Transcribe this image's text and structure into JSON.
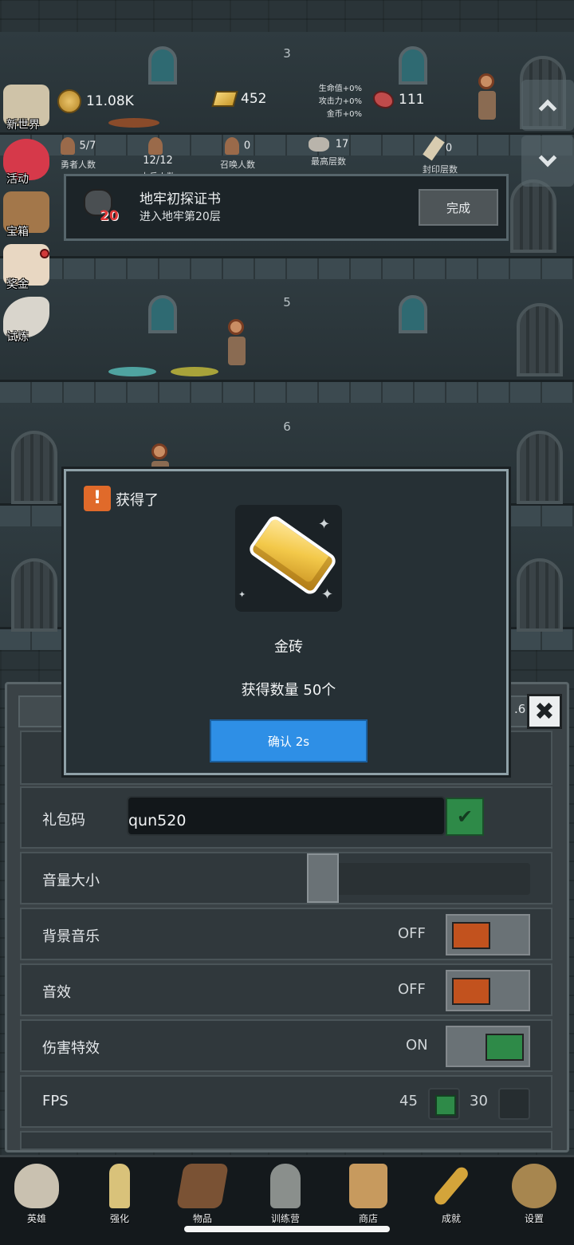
{
  "floors": [
    {
      "label": "3"
    },
    {
      "label": "5"
    },
    {
      "label": "6"
    }
  ],
  "hud": {
    "gold": "11.08K",
    "gold_bars": "452",
    "bonus_lines": [
      "生命值+0%",
      "攻击力+0%",
      "金币+0%"
    ],
    "gems": "111",
    "stats": [
      {
        "value": "5/7",
        "label": "勇者人数"
      },
      {
        "value": "12/12",
        "label": "士兵人数"
      },
      {
        "value": "0",
        "label": "召唤人数"
      },
      {
        "value": "17",
        "label": "最高层数"
      },
      {
        "value": "0",
        "label": "封印层数"
      }
    ]
  },
  "side_menu": [
    {
      "label": "新世界"
    },
    {
      "label": "活动"
    },
    {
      "label": "宝箱"
    },
    {
      "label": "奖金"
    },
    {
      "label": "试炼"
    }
  ],
  "quest": {
    "title": "地牢初探证书",
    "description": "进入地牢第20层",
    "badge_number": "20",
    "button": "完成"
  },
  "modal": {
    "title": "获得了",
    "alert_icon": "!",
    "item_name": "金砖",
    "quantity_text": "获得数量 50个",
    "confirm_label": "确认 2s"
  },
  "settings": {
    "version_fragment": ".6",
    "close_glyph": "✖",
    "gift_code": {
      "label": "礼包码",
      "value": "qun520",
      "confirm_glyph": "✔"
    },
    "volume": {
      "label": "音量大小",
      "level": 0.0
    },
    "bgm": {
      "label": "背景音乐",
      "state": "OFF"
    },
    "sfx": {
      "label": "音效",
      "state": "OFF"
    },
    "damage_fx": {
      "label": "伤害特效",
      "state": "ON"
    },
    "fps": {
      "label": "FPS",
      "options": [
        "45",
        "30"
      ],
      "selected": "45"
    }
  },
  "bottom_nav": [
    {
      "label": "英雄",
      "icon": "skull-icon",
      "color": "#c9c1b0"
    },
    {
      "label": "强化",
      "icon": "candle-icon",
      "color": "#d9c27a"
    },
    {
      "label": "物品",
      "icon": "book-icon",
      "color": "#7a5234"
    },
    {
      "label": "训练营",
      "icon": "lantern-icon",
      "color": "#8a8f8c"
    },
    {
      "label": "商店",
      "icon": "mug-icon",
      "color": "#c79a5e"
    },
    {
      "label": "成就",
      "icon": "key-icon",
      "color": "#d4a43a"
    },
    {
      "label": "设置",
      "icon": "gear-icon",
      "color": "#a7864f"
    }
  ],
  "colors": {
    "confirm_button": "#2e8fe6",
    "toggle_off": "#c2521e",
    "toggle_on": "#2e8a48",
    "alert": "#e06a2a"
  }
}
